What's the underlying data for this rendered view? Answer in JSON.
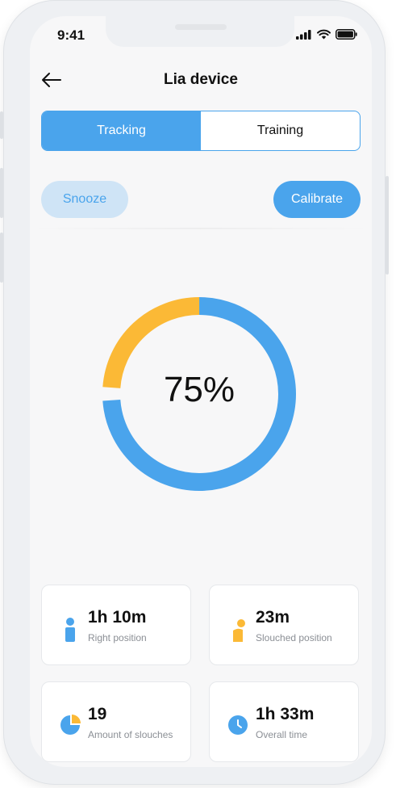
{
  "status_bar": {
    "time": "9:41"
  },
  "header": {
    "title": "Lia device"
  },
  "tabs": [
    {
      "label": "Tracking",
      "active": true
    },
    {
      "label": "Training",
      "active": false
    }
  ],
  "actions": {
    "snooze_label": "Snooze",
    "calibrate_label": "Calibrate"
  },
  "progress": {
    "percent_label": "75%",
    "value": 0.75
  },
  "stats": [
    {
      "value": "1h 10m",
      "label": "Right position",
      "icon": "person-upright-icon"
    },
    {
      "value": "23m",
      "label": "Slouched position",
      "icon": "person-slouched-icon"
    },
    {
      "value": "19",
      "label": "Amount of slouches",
      "icon": "pie-chart-icon"
    },
    {
      "value": "1h 33m",
      "label": "Overall time",
      "icon": "clock-icon"
    }
  ],
  "colors": {
    "primary": "#4aa4ec",
    "secondary": "#fbb936",
    "light_primary": "#cfe4f6"
  }
}
